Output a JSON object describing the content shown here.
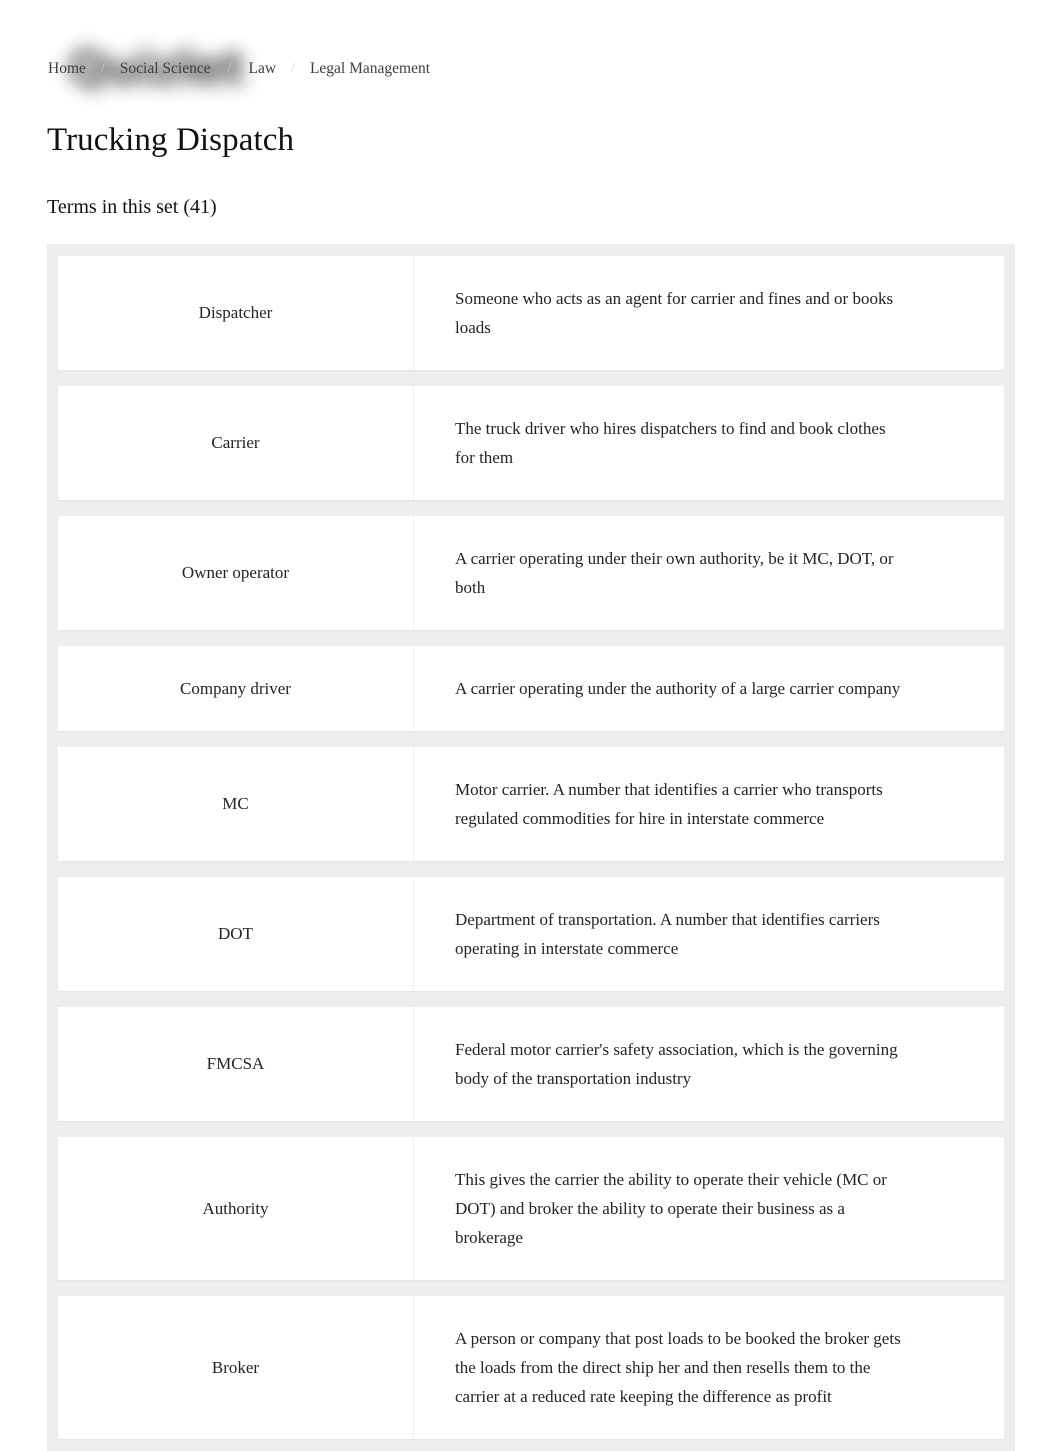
{
  "breadcrumb": {
    "separator": "/",
    "items": [
      {
        "label": "Home"
      },
      {
        "label": "Social Science"
      },
      {
        "label": "Law"
      },
      {
        "label": "Legal Management"
      }
    ]
  },
  "watermark": {
    "label": "Quizlet"
  },
  "page": {
    "title": "Trucking Dispatch",
    "terms_heading": "Terms in this set (41)"
  },
  "terms": [
    {
      "term": "Dispatcher",
      "definition": "Someone who acts as an agent for carrier and fines and or books loads"
    },
    {
      "term": "Carrier",
      "definition": "The truck driver who hires dispatchers to find and book clothes for them"
    },
    {
      "term": "Owner operator",
      "definition": "A carrier operating under their own authority, be it MC, DOT, or both"
    },
    {
      "term": "Company driver",
      "definition": "A carrier operating under the authority of a large carrier company"
    },
    {
      "term": "MC",
      "definition": "Motor carrier. A number that identifies a carrier who transports regulated commodities for hire in interstate commerce"
    },
    {
      "term": "DOT",
      "definition": "Department of transportation. A number that identifies carriers operating in interstate commerce"
    },
    {
      "term": "FMCSA",
      "definition": "Federal motor carrier's safety association, which is the governing body of the transportation industry"
    },
    {
      "term": "Authority",
      "definition": "This gives the carrier the ability to operate their vehicle (MC or DOT) and broker the ability to operate their business as a brokerage"
    },
    {
      "term": "Broker",
      "definition": "A person or company that post loads to be booked the broker gets the loads from the direct ship her and then resells them to the carrier at a reduced rate keeping the difference as profit"
    }
  ]
}
